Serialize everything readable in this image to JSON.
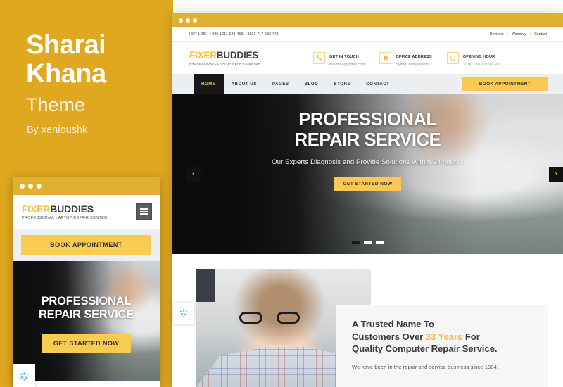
{
  "promo": {
    "title_line1": "Sharai",
    "title_line2": "Khana",
    "subtitle": "Theme",
    "author": "By xenioushk"
  },
  "site": {
    "logo_primary": "FIXER",
    "logo_secondary": "BUDDIES",
    "logo_tagline": "PROFESSIONAL LAPTOP REPAIR CENTER"
  },
  "desktop": {
    "topbar": {
      "hotline": "HOT LINE : +880-1911-623-458, +8801-717-682-743",
      "links": [
        "Reviews",
        "Warranty",
        "Contact"
      ],
      "separator": "|"
    },
    "header_infos": [
      {
        "icon": "phone-icon",
        "title": "GET IN TOUCH",
        "text": "example@gmail.com"
      },
      {
        "icon": "home-icon",
        "title": "OFFICE ADDRESS",
        "text": "Sylhet, Bangladesh"
      },
      {
        "icon": "clock-icon",
        "title": "OPENING HOUR",
        "text": "10.00 - 18.00 UTC+06"
      }
    ],
    "nav": {
      "items": [
        "HOME",
        "ABOUT US",
        "PAGES",
        "BLOG",
        "STORE",
        "CONTACT"
      ],
      "active_index": 0,
      "appointment_button": "BOOK APPOINTMENT"
    },
    "hero": {
      "headline_line1": "PROFESSIONAL",
      "headline_line2": "REPAIR SERVICE",
      "subtext": "Our Experts Diagnosis and Provide Solutions Within 24 hours !",
      "cta": "GET STARTED NOW",
      "prev_arrow": "‹",
      "next_arrow": "›",
      "slides": 3,
      "active_slide": 0
    },
    "about": {
      "heading_line1": "A Trusted Name To",
      "heading_line2_pre": "Customers Over ",
      "heading_line2_hl": "33 Years",
      "heading_line2_post": " For",
      "heading_line3": "Quality Computer Repair Service.",
      "paragraph": "We have been in the repair and service business since 1984."
    }
  },
  "mobile": {
    "appointment_button": "BOOK APPOINTMENT",
    "menu_icon": "hamburger-icon",
    "hero": {
      "headline_line1": "PROFESSIONAL",
      "headline_line2": "REPAIR SERVICE",
      "cta": "GET STARTED NOW"
    }
  },
  "badges": {
    "recycle_icon": "recycle-icon"
  },
  "colors": {
    "brand_yellow": "#e0a81f",
    "accent_yellow": "#fac94f",
    "logo_yellow": "#f6c041",
    "dark": "#18181a",
    "nav_bg": "#eceff1",
    "card_bg": "#f6f6f6"
  }
}
